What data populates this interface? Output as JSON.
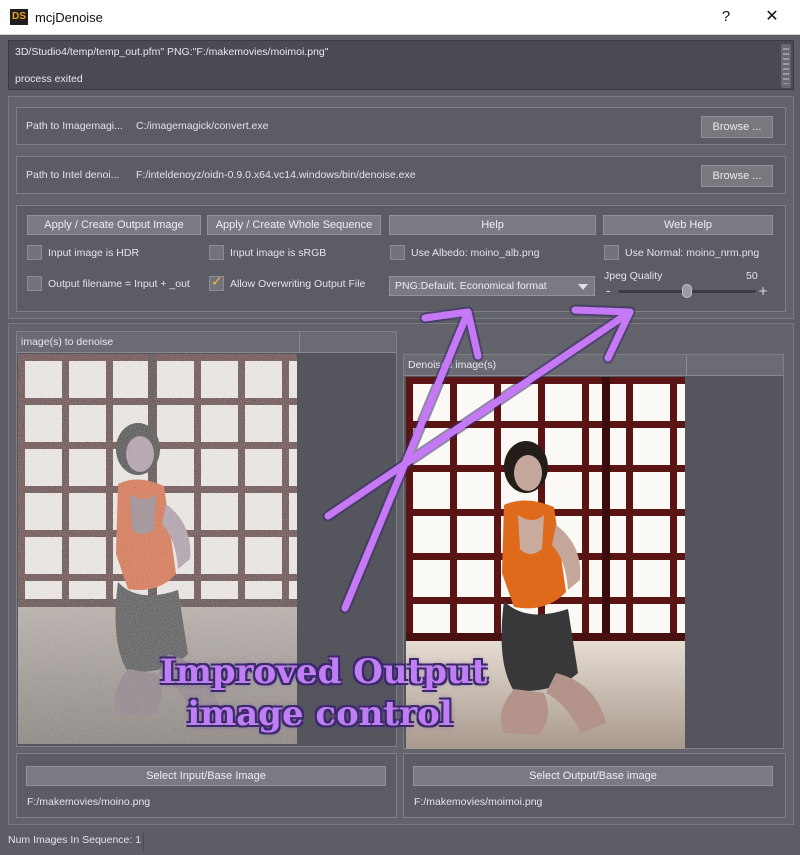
{
  "window": {
    "app_icon_text": "DS",
    "title": "mcjDenoise",
    "help_button": "?",
    "close_button": "✕"
  },
  "log": {
    "line1": "3D/Studio4/temp/temp_out.pfm\" PNG:\"F:/makemovies/moimoi.png\"",
    "line2": "process exited"
  },
  "paths": {
    "imagemagick_label": "Path to Imagemagi...",
    "imagemagick_value": "C:/imagemagick/convert.exe",
    "denoiser_label": "Path to Intel denoi...",
    "denoiser_value": "F:/inteldenoyz/oidn-0.9.0.x64.vc14.windows/bin/denoise.exe",
    "browse_label": "Browse ..."
  },
  "buttons": {
    "apply_output": "Apply / Create Output Image",
    "apply_sequence": "Apply / Create Whole Sequence",
    "help": "Help",
    "web_help": "Web Help"
  },
  "checkboxes": {
    "input_hdr": "Input image is HDR",
    "input_srgb": "Input image is sRGB",
    "use_albedo": "Use Albedo: moino_alb.png",
    "use_normal": "Use Normal: moino_nrm.png",
    "output_filename": "Output filename = Input + _out",
    "allow_overwrite": "Allow Overwriting Output File"
  },
  "checkbox_states": {
    "input_hdr": false,
    "input_srgb": false,
    "use_albedo": false,
    "use_normal": false,
    "output_filename": false,
    "allow_overwrite": true
  },
  "format_select": {
    "selected": "PNG:Default. Economical format"
  },
  "jpeg_quality": {
    "label": "Jpeg Quality",
    "value": "50",
    "minus": "-",
    "plus": "+",
    "level": 0.5
  },
  "panes": {
    "input_title": "image(s) to denoise",
    "output_title": "Denoised image(s)",
    "select_input_button": "Select Input/Base Image",
    "select_output_button": "Select Output/Base image",
    "input_path": "F:/makemovies/moino.png",
    "output_path": "F:/makemovies/moimoi.png"
  },
  "status": {
    "text": "Num Images In Sequence: 1"
  },
  "annotation": {
    "line1": "Improved Output",
    "line2": "image control",
    "color": "#c07ef5"
  },
  "colors": {
    "panel_bg": "#5d5d66",
    "button_bg": "#7a7a82",
    "checkmark": "#f2b830",
    "outfit_orange": "#e06a1c"
  }
}
